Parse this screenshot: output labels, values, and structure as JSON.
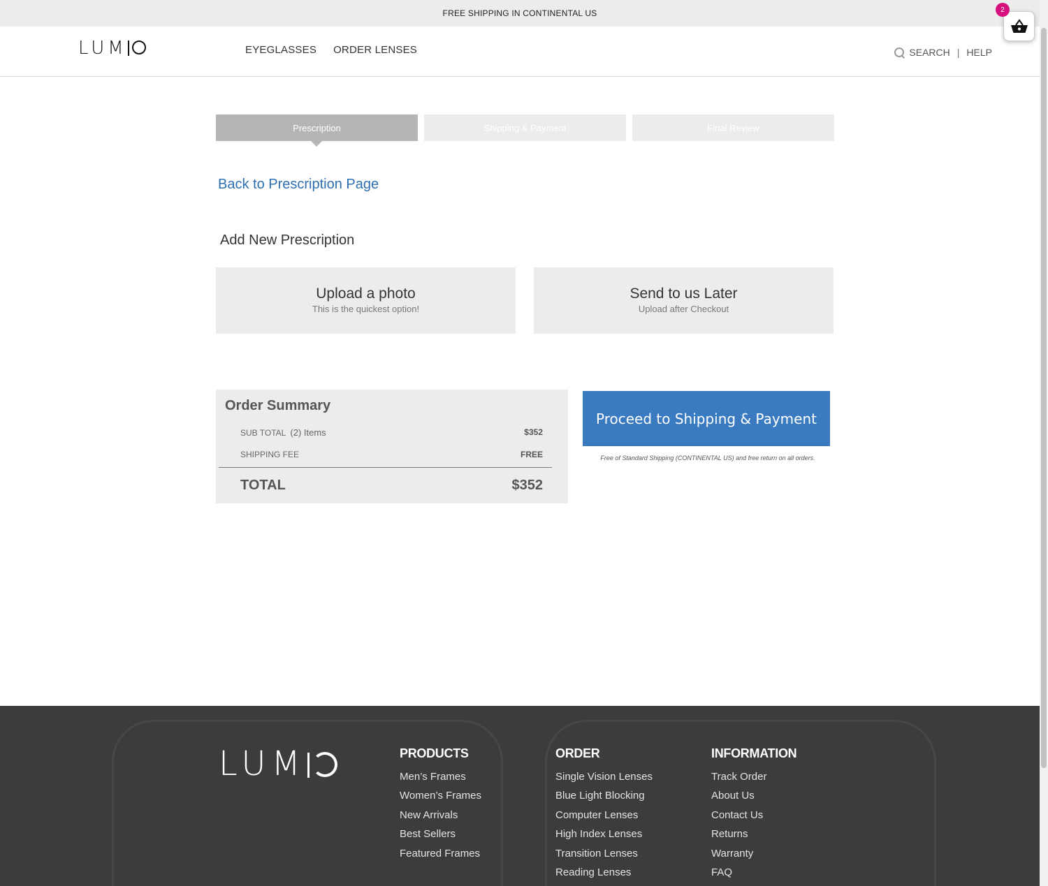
{
  "announcement": "FREE SHIPPING IN CONTINENTAL US",
  "header": {
    "logo": "LUMIO",
    "nav": [
      "EYEGLASSES",
      "ORDER LENSES"
    ],
    "search_label": "SEARCH",
    "divider": "|",
    "help_label": "HELP",
    "cart_count": "2"
  },
  "steps": [
    "Prescription",
    "Shipping & Payment",
    "Final Review"
  ],
  "back_link": "Back to Prescription Page",
  "section_title": "Add New Prescription",
  "options": [
    {
      "title": "Upload a photo",
      "subtitle": "This is the quickest option!"
    },
    {
      "title": "Send to us Later",
      "subtitle": "Upload after Checkout"
    }
  ],
  "summary": {
    "title": "Order Summary",
    "subtotal_label": "SUB TOTAL",
    "items": "(2) Items",
    "subtotal_value": "$352",
    "shipping_label": "SHIPPING FEE",
    "shipping_value": "FREE",
    "total_label": "TOTAL",
    "total_value": "$352"
  },
  "proceed_label": "Proceed to Shipping & Payment",
  "shipping_note": "Free of Standard Shipping (CONTINENTAL US) and free return on all orders.",
  "footer": {
    "logo": "LUMIO",
    "columns": [
      {
        "title": "PRODUCTS",
        "links": [
          "Men’s Frames",
          "Women’s Frames",
          "New Arrivals",
          "Best Sellers",
          "Featured Frames"
        ]
      },
      {
        "title": "ORDER",
        "links": [
          "Single Vision Lenses",
          "Blue Light Blocking",
          "Computer Lenses",
          "High Index Lenses",
          "Transition Lenses",
          "Reading Lenses"
        ]
      },
      {
        "title": "INFORMATION",
        "links": [
          "Track Order",
          "About Us",
          "Contact Us",
          "Returns",
          "Warranty",
          "FAQ"
        ]
      }
    ]
  },
  "colors": {
    "accent": "#3a7ac1",
    "link": "#2c6fb0",
    "badge": "#d6117f",
    "footer_bg": "#3c3c3c"
  }
}
